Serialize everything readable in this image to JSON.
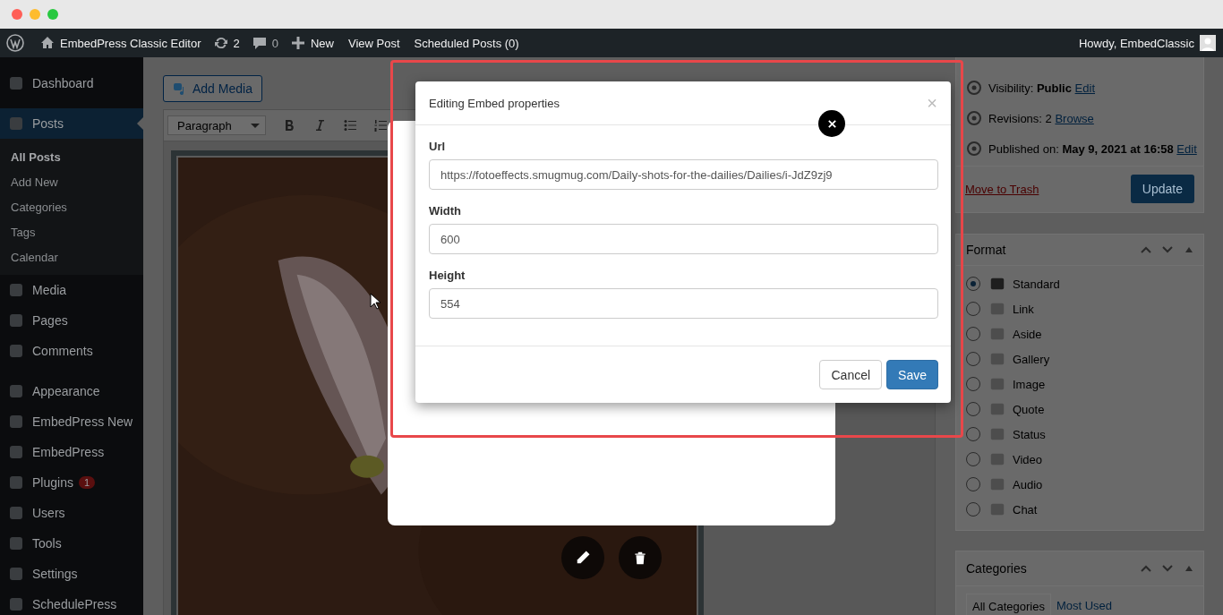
{
  "admin_bar": {
    "site": "EmbedPress Classic Editor",
    "updates": "2",
    "comments": "0",
    "new": "New",
    "links": [
      "View Post",
      "Scheduled Posts (0)"
    ],
    "greeting": "Howdy, EmbedClassic"
  },
  "sidebar": {
    "groups": [
      {
        "items": [
          {
            "label": "Dashboard",
            "selected": false
          }
        ]
      },
      {
        "items": [
          {
            "label": "Posts",
            "selected": true,
            "children": [
              {
                "label": "All Posts",
                "selected": true
              },
              {
                "label": "Add New",
                "selected": false
              },
              {
                "label": "Categories",
                "selected": false
              },
              {
                "label": "Tags",
                "selected": false
              },
              {
                "label": "Calendar",
                "selected": false
              }
            ]
          },
          {
            "label": "Media",
            "selected": false
          },
          {
            "label": "Pages",
            "selected": false
          },
          {
            "label": "Comments",
            "selected": false
          }
        ]
      },
      {
        "items": [
          {
            "label": "Appearance",
            "selected": false
          },
          {
            "label": "EmbedPress New",
            "selected": false
          },
          {
            "label": "EmbedPress",
            "selected": false
          },
          {
            "label": "Plugins",
            "selected": false,
            "badge": "1"
          },
          {
            "label": "Users",
            "selected": false
          },
          {
            "label": "Tools",
            "selected": false
          },
          {
            "label": "Settings",
            "selected": false
          },
          {
            "label": "SchedulePress",
            "selected": false
          }
        ]
      }
    ]
  },
  "editor": {
    "add_media": "Add Media",
    "block_format": "Paragraph"
  },
  "modal": {
    "title": "Editing Embed properties",
    "close": "×",
    "fields": [
      {
        "label": "Url",
        "value": "https://fotoeffects.smugmug.com/Daily-shots-for-the-dailies/Dailies/i-JdZ9zj9"
      },
      {
        "label": "Width",
        "value": "600"
      },
      {
        "label": "Height",
        "value": "554"
      }
    ],
    "buttons": [
      {
        "label": "Cancel",
        "primary": false
      },
      {
        "label": "Save",
        "primary": true
      }
    ]
  },
  "publish": {
    "rows": [
      {
        "text": "Visibility: **Public**",
        "link": "Edit"
      },
      {
        "text": "Revisions: 2",
        "link": "Browse"
      },
      {
        "text": "Published on: **May 9, 2021 at 16:58**",
        "link": "Edit"
      }
    ],
    "trash": "Move to Trash",
    "update": "Update"
  },
  "format": {
    "title": "Format",
    "options": [
      {
        "label": "Standard",
        "selected": true
      },
      {
        "label": "Link",
        "selected": false
      },
      {
        "label": "Aside",
        "selected": false
      },
      {
        "label": "Gallery",
        "selected": false
      },
      {
        "label": "Image",
        "selected": false
      },
      {
        "label": "Quote",
        "selected": false
      },
      {
        "label": "Status",
        "selected": false
      },
      {
        "label": "Video",
        "selected": false
      },
      {
        "label": "Audio",
        "selected": false
      },
      {
        "label": "Chat",
        "selected": false
      }
    ]
  },
  "categories": {
    "title": "Categories",
    "tabs": [
      {
        "label": "All Categories",
        "selected": true
      },
      {
        "label": "Most Used",
        "selected": false
      }
    ]
  }
}
